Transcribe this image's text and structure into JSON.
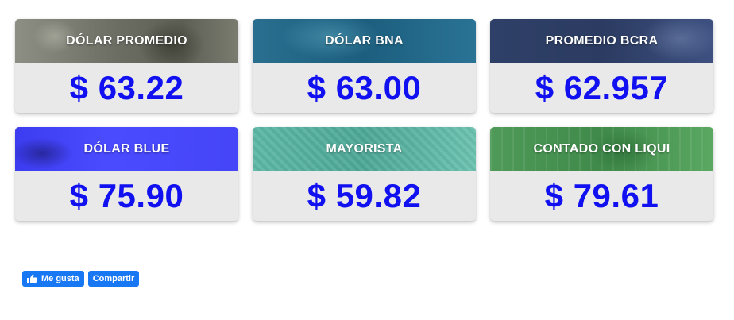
{
  "cards": [
    {
      "title": "DÓLAR PROMEDIO",
      "price": "$ 63.22"
    },
    {
      "title": "DÓLAR BNA",
      "price": "$ 63.00"
    },
    {
      "title": "PROMEDIO BCRA",
      "price": "$ 62.957"
    },
    {
      "title": "DÓLAR BLUE",
      "price": "$ 75.90"
    },
    {
      "title": "MAYORISTA",
      "price": "$ 59.82"
    },
    {
      "title": "CONTADO CON LIQUI",
      "price": "$ 79.61"
    }
  ],
  "social": {
    "like_label": "Me gusta",
    "like_icon": "thumbs-up-icon",
    "share_label": "Compartir"
  },
  "colors": {
    "price_text": "#1010f0",
    "card_body_bg": "#e9e9e9",
    "facebook_blue": "#1877f2"
  }
}
